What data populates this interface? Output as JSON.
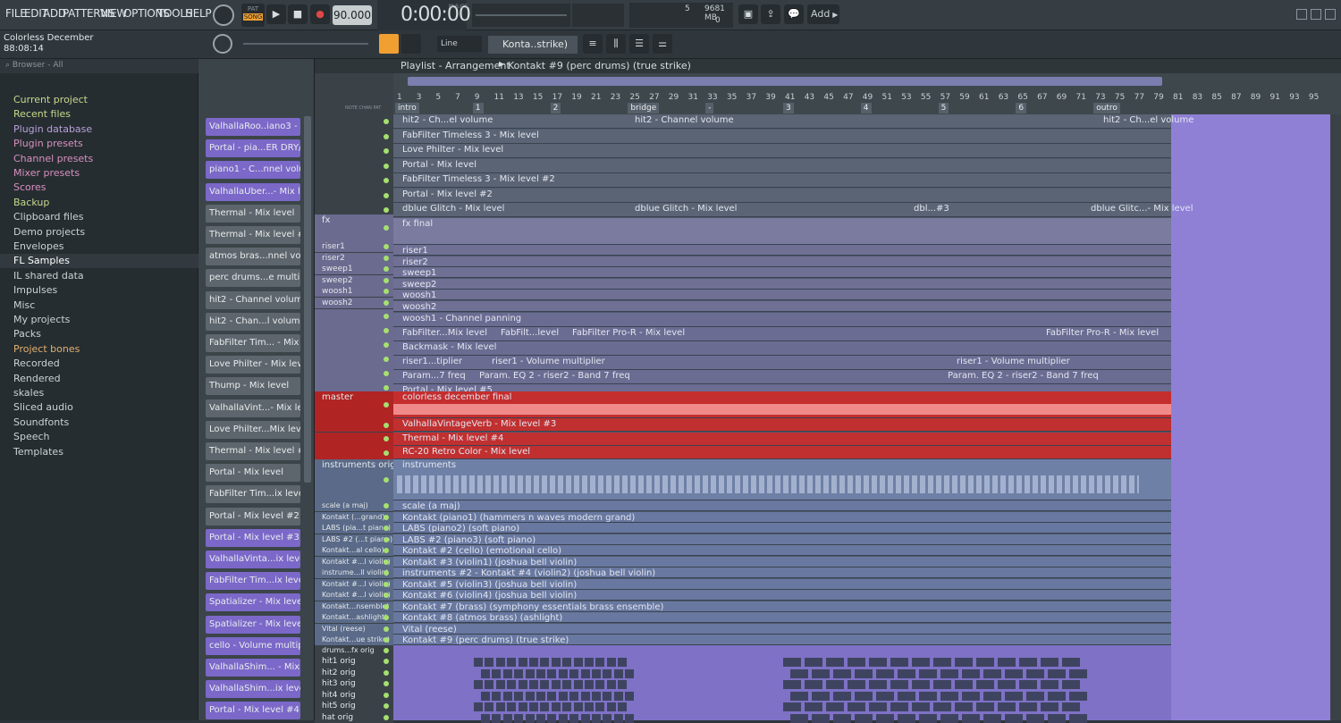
{
  "menu": [
    "FILE",
    "EDIT",
    "ADD",
    "PATTERNS",
    "VIEW",
    "OPTIONS",
    "TOOLS",
    "HELP"
  ],
  "transport": {
    "pat_label": "PAT",
    "song_label": "SONG",
    "tempo": "90.000",
    "time": "0:00:00",
    "time_unit": "M:S:CS",
    "cpu": "5",
    "memory": "9681 MB",
    "poly": "0",
    "add_label": "Add"
  },
  "song": {
    "title": "Colorless December",
    "time": "88:08:14"
  },
  "toolbar2": {
    "snap": "Line",
    "channel": "Konta..strike)"
  },
  "browser": {
    "header": "Browser - All",
    "items": [
      {
        "label": "Current project",
        "color": "#c8d88a"
      },
      {
        "label": "Recent files",
        "color": "#c8d88a"
      },
      {
        "label": "Plugin database",
        "color": "#b7a0d8"
      },
      {
        "label": "Plugin presets",
        "color": "#d890c0"
      },
      {
        "label": "Channel presets",
        "color": "#d890c0"
      },
      {
        "label": "Mixer presets",
        "color": "#d890c0"
      },
      {
        "label": "Scores",
        "color": "#d890c0"
      },
      {
        "label": "Backup",
        "color": "#c8d88a"
      },
      {
        "label": "Clipboard files",
        "color": "#c9d2d6"
      },
      {
        "label": "Demo projects",
        "color": "#c9d2d6"
      },
      {
        "label": "Envelopes",
        "color": "#c9d2d6"
      },
      {
        "label": "FL Samples",
        "color": "#ffffff"
      },
      {
        "label": "IL shared data",
        "color": "#c9d2d6"
      },
      {
        "label": "Impulses",
        "color": "#c9d2d6"
      },
      {
        "label": "Misc",
        "color": "#c9d2d6"
      },
      {
        "label": "My projects",
        "color": "#c9d2d6"
      },
      {
        "label": "Packs",
        "color": "#c9d2d6"
      },
      {
        "label": "Project bones",
        "color": "#e0b070"
      },
      {
        "label": "Recorded",
        "color": "#c9d2d6"
      },
      {
        "label": "Rendered",
        "color": "#c9d2d6"
      },
      {
        "label": "skales",
        "color": "#c9d2d6"
      },
      {
        "label": "Sliced audio",
        "color": "#c9d2d6"
      },
      {
        "label": "Soundfonts",
        "color": "#c9d2d6"
      },
      {
        "label": "Speech",
        "color": "#c9d2d6"
      },
      {
        "label": "Templates",
        "color": "#c9d2d6"
      }
    ]
  },
  "patterns": [
    {
      "label": "ValhallaRoo..iano3 - mix",
      "color": "#7b68c8"
    },
    {
      "label": "Portal - pia...ER DRY/WET",
      "color": "#7b68c8"
    },
    {
      "label": "piano1 - C...nnel volume",
      "color": "#7b68c8"
    },
    {
      "label": "ValhallaUber...- Mix level",
      "color": "#7b68c8"
    },
    {
      "label": "Thermal - Mix level",
      "color": "#5d666c"
    },
    {
      "label": "Thermal - Mix level #2",
      "color": "#5d666c"
    },
    {
      "label": "atmos bras...nnel volume",
      "color": "#5d666c"
    },
    {
      "label": "perc drums...e multiplier",
      "color": "#5d666c"
    },
    {
      "label": "hit2 - Channel volume",
      "color": "#5d666c"
    },
    {
      "label": "hit2 - Chan...l volume #2",
      "color": "#5d666c"
    },
    {
      "label": "FabFilter Tim... - Mix level",
      "color": "#5d666c"
    },
    {
      "label": "Love Philter - Mix level",
      "color": "#5d666c"
    },
    {
      "label": "Thump - Mix level",
      "color": "#5d666c"
    },
    {
      "label": "ValhallaVint...- Mix level",
      "color": "#5d666c"
    },
    {
      "label": "Love Philter...Mix level #2",
      "color": "#5d666c"
    },
    {
      "label": "Thermal - Mix level #3",
      "color": "#5d666c"
    },
    {
      "label": "Portal - Mix level",
      "color": "#5d666c"
    },
    {
      "label": "FabFilter Tim...ix level #2",
      "color": "#5d666c"
    },
    {
      "label": "Portal - Mix level #2",
      "color": "#5d666c"
    },
    {
      "label": "Portal - Mix level #3",
      "color": "#7b68c8"
    },
    {
      "label": "ValhallaVinta...ix level #2",
      "color": "#7b68c8"
    },
    {
      "label": "FabFilter Tim...ix level #3",
      "color": "#7b68c8"
    },
    {
      "label": "Spatializer - Mix level",
      "color": "#7b68c8"
    },
    {
      "label": "Spatializer - Mix level #2",
      "color": "#7b68c8"
    },
    {
      "label": "cello - Volume multiplier",
      "color": "#7b68c8"
    },
    {
      "label": "ValhallaShim... - Mix level",
      "color": "#7b68c8"
    },
    {
      "label": "ValhallaShim...ix level #2",
      "color": "#7b68c8"
    },
    {
      "label": "Portal - Mix level #4",
      "color": "#7b68c8"
    }
  ],
  "playlist": {
    "title": "Playlist - Arrangement",
    "pattern": "Kontakt #9 (perc drums) (true strike)",
    "col_labels": [
      "NOTE",
      "CHAN",
      "PAT"
    ],
    "markers": [
      {
        "label": "intro",
        "bar": 1
      },
      {
        "label": "1",
        "bar": 9
      },
      {
        "label": "2",
        "bar": 17
      },
      {
        "label": "bridge",
        "bar": 25
      },
      {
        "label": "-",
        "bar": 33
      },
      {
        "label": "3",
        "bar": 41
      },
      {
        "label": "4",
        "bar": 49
      },
      {
        "label": "5",
        "bar": 57
      },
      {
        "label": "6",
        "bar": 65
      },
      {
        "label": "outro",
        "bar": 73
      }
    ],
    "bar_numbers": [
      "1",
      "3",
      "5",
      "7",
      "9",
      "11",
      "13",
      "15",
      "17",
      "19",
      "21",
      "23",
      "25",
      "27",
      "29",
      "31",
      "33",
      "35",
      "37",
      "39",
      "41",
      "43",
      "45",
      "47",
      "49",
      "51",
      "53",
      "55",
      "57",
      "59",
      "61",
      "63",
      "65",
      "67",
      "69",
      "71",
      "73",
      "75",
      "77",
      "79",
      "81",
      "83",
      "85",
      "87",
      "89",
      "91",
      "93",
      "95"
    ]
  },
  "track_names": {
    "fx": "fx",
    "fx_sub": [
      "riser1",
      "riser2",
      "sweep1",
      "sweep2",
      "woosh1",
      "woosh2"
    ],
    "master": "master",
    "instruments": "instruments orig",
    "inst_sub": [
      "scale (a maj)",
      "Kontakt (...grand)",
      "LABS (pia...t piano)",
      "LABS #2 (...t piano)",
      "Kontakt...al cello)",
      "Kontakt #...l violin)",
      "instrume...ll violin)",
      "Kontakt #...l violin)",
      "Kontakt #...l violin)",
      "Kontakt...nsemble)",
      "Kontakt...ashlight)",
      "Vital (reese)",
      "Kontakt...ue strike)"
    ],
    "drums": "drums...fx orig",
    "drum_sub": [
      "hit1 orig",
      "hit2 orig",
      "hit3 orig",
      "hit4 orig",
      "hit5 orig",
      "hat orig"
    ]
  },
  "lanes": {
    "auto_top": [
      "hit2 - Ch...el volume",
      "FabFilter Timeless 3 - Mix level",
      "Love Philter - Mix level",
      "Portal - Mix level",
      "FabFilter Timeless 3 - Mix level #2",
      "Portal - Mix level #2",
      "dblue Glitch - Mix level"
    ],
    "fx_final": "fx final",
    "fx_sub": [
      "riser1",
      "riser2",
      "sweep1",
      "sweep2",
      "woosh1",
      "woosh2"
    ],
    "auto_mid": [
      "woosh1 - Channel panning",
      "FabFilter...Mix level",
      "Backmask - Mix level",
      "riser1...tiplier",
      "Param...7 freq",
      "Portal - Mix level #5"
    ],
    "master_clip": "colorless december final",
    "master_auto": [
      "ValhallaVintageVerb - Mix level #3",
      "Thermal - Mix level #4",
      "RC-20 Retro Color - Mix level"
    ],
    "instruments_clip": "instruments",
    "inst_sub": [
      "scale (a maj)",
      "Kontakt (piano1) (hammers n waves modern grand)",
      "LABS (piano2) (soft piano)",
      "LABS #2 (piano3) (soft piano)",
      "Kontakt #2 (cello) (emotional cello)",
      "Kontakt #3 (violin1) (joshua bell violin)",
      "instruments #2 - Kontakt #4 (violin2) (joshua bell violin)",
      "Kontakt #5 (violin3) (joshua bell violin)",
      "Kontakt #6 (violin4) (joshua bell violin)",
      "Kontakt #7 (brass) (symphony essentials brass ensemble)",
      "Kontakt #8 (atmos brass) (ashlight)",
      "Vital (reese)",
      "Kontakt #9 (perc drums) (true strike)"
    ],
    "extra_labels": [
      "hit2 - Channel volume",
      "hit2 - Ch...el volume",
      "FabFilter Pro-R - Mix level",
      "FabFilt...level",
      "riser1 - Volume multiplier",
      "Param. EQ 2 - riser2 - Band 7 freq",
      "dblue Glitch - Mix level",
      "dbl...#3",
      "dblue Glitc...- Mix level"
    ]
  }
}
